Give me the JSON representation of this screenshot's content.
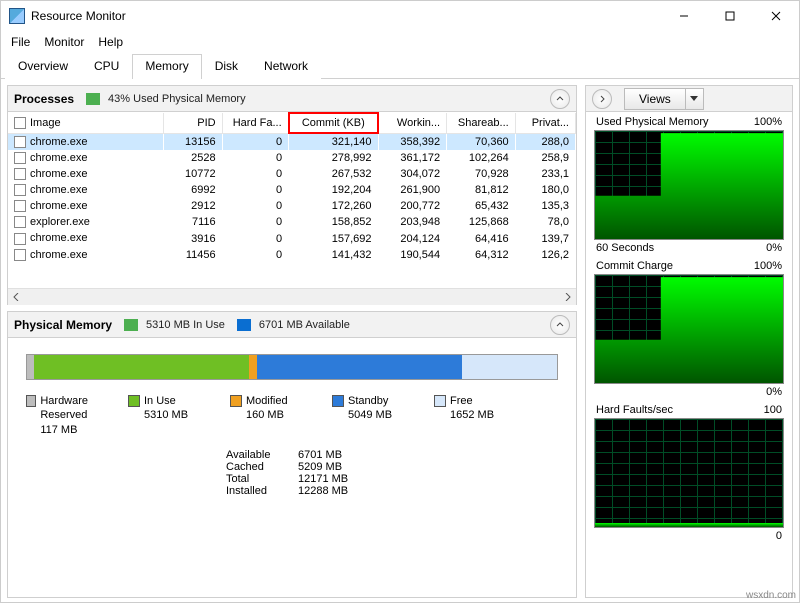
{
  "title": "Resource Monitor",
  "menu": {
    "file": "File",
    "monitor": "Monitor",
    "help": "Help"
  },
  "tabs": {
    "overview": "Overview",
    "cpu": "CPU",
    "memory": "Memory",
    "disk": "Disk",
    "network": "Network",
    "active": "Memory"
  },
  "processes": {
    "title": "Processes",
    "phys_used": "43% Used Physical Memory",
    "columns": {
      "image": "Image",
      "pid": "PID",
      "hard": "Hard Fa...",
      "commit": "Commit (KB)",
      "working": "Workin...",
      "share": "Shareab...",
      "priv": "Privat..."
    },
    "rows": [
      {
        "image": "chrome.exe",
        "pid": "13156",
        "hard": "0",
        "commit": "321,140",
        "working": "358,392",
        "share": "70,360",
        "priv": "288,0"
      },
      {
        "image": "chrome.exe",
        "pid": "2528",
        "hard": "0",
        "commit": "278,992",
        "working": "361,172",
        "share": "102,264",
        "priv": "258,9"
      },
      {
        "image": "chrome.exe",
        "pid": "10772",
        "hard": "0",
        "commit": "267,532",
        "working": "304,072",
        "share": "70,928",
        "priv": "233,1"
      },
      {
        "image": "chrome.exe",
        "pid": "6992",
        "hard": "0",
        "commit": "192,204",
        "working": "261,900",
        "share": "81,812",
        "priv": "180,0"
      },
      {
        "image": "chrome.exe",
        "pid": "2912",
        "hard": "0",
        "commit": "172,260",
        "working": "200,772",
        "share": "65,432",
        "priv": "135,3"
      },
      {
        "image": "explorer.exe",
        "pid": "7116",
        "hard": "0",
        "commit": "158,852",
        "working": "203,948",
        "share": "125,868",
        "priv": "78,0"
      },
      {
        "image": "chrome.exe",
        "pid": "3916",
        "hard": "0",
        "commit": "157,692",
        "working": "204,124",
        "share": "64,416",
        "priv": "139,7"
      },
      {
        "image": "chrome.exe",
        "pid": "11456",
        "hard": "0",
        "commit": "141,432",
        "working": "190,544",
        "share": "64,312",
        "priv": "126,2"
      }
    ]
  },
  "physical": {
    "title": "Physical Memory",
    "in_use": "5310 MB In Use",
    "available": "6701 MB Available",
    "legend": {
      "hw": {
        "label": "Hardware Reserved",
        "val": "117 MB"
      },
      "in": {
        "label": "In Use",
        "val": "5310 MB"
      },
      "mo": {
        "label": "Modified",
        "val": "160 MB"
      },
      "sb": {
        "label": "Standby",
        "val": "5049 MB"
      },
      "fr": {
        "label": "Free",
        "val": "1652 MB"
      }
    },
    "kv": {
      "available": {
        "k": "Available",
        "v": "6701 MB"
      },
      "cached": {
        "k": "Cached",
        "v": "5209 MB"
      },
      "total": {
        "k": "Total",
        "v": "12171 MB"
      },
      "installed": {
        "k": "Installed",
        "v": "12288 MB"
      }
    }
  },
  "right": {
    "views": "Views",
    "charts": {
      "c1": {
        "title": "Used Physical Memory",
        "max": "100%",
        "btitle": "60 Seconds",
        "bmax": "0%"
      },
      "c2": {
        "title": "Commit Charge",
        "max": "100%",
        "bmax": "0%"
      },
      "c3": {
        "title": "Hard Faults/sec",
        "max": "100",
        "bmax": "0"
      }
    }
  },
  "chart_data": [
    {
      "type": "area",
      "title": "Used Physical Memory",
      "ylabel": "%",
      "ylim": [
        0,
        100
      ],
      "x_seconds": 60,
      "values_pct": [
        40,
        40,
        40,
        40,
        40,
        40,
        40,
        40,
        40,
        40,
        40,
        40,
        40,
        40,
        40,
        40,
        40,
        40,
        40,
        40,
        40,
        98,
        98,
        98,
        98,
        98,
        98,
        98,
        98,
        98,
        98,
        98,
        98,
        98,
        98,
        98,
        98,
        98,
        98,
        98,
        98,
        98,
        98,
        98,
        98,
        98,
        98,
        98,
        98,
        98,
        98,
        98,
        98,
        98,
        98,
        98,
        98,
        98,
        98,
        98
      ]
    },
    {
      "type": "area",
      "title": "Commit Charge",
      "ylabel": "%",
      "ylim": [
        0,
        100
      ],
      "x_seconds": 60,
      "values_pct": [
        40,
        40,
        40,
        40,
        40,
        40,
        40,
        40,
        40,
        40,
        40,
        40,
        40,
        40,
        40,
        40,
        40,
        40,
        40,
        40,
        40,
        98,
        98,
        98,
        98,
        98,
        98,
        98,
        98,
        98,
        98,
        98,
        98,
        98,
        98,
        98,
        98,
        98,
        98,
        98,
        98,
        98,
        98,
        98,
        98,
        98,
        98,
        98,
        98,
        98,
        98,
        98,
        98,
        98,
        98,
        98,
        98,
        98,
        98,
        98
      ]
    },
    {
      "type": "area",
      "title": "Hard Faults/sec",
      "ylabel": "faults/s",
      "ylim": [
        0,
        100
      ],
      "x_seconds": 60,
      "values": [
        0,
        0,
        1,
        0,
        0,
        0,
        2,
        0,
        0,
        1,
        0,
        0,
        0,
        0,
        1,
        0,
        0,
        0,
        0,
        0,
        0,
        2,
        0,
        0,
        0,
        1,
        0,
        0,
        0,
        0,
        1,
        0,
        0,
        0,
        0,
        0,
        0,
        2,
        0,
        0,
        0,
        0,
        1,
        0,
        0,
        0,
        0,
        0,
        0,
        0,
        1,
        0,
        0,
        0,
        0,
        0,
        2,
        0,
        0,
        0
      ]
    }
  ],
  "watermark": "wsxdn.com"
}
